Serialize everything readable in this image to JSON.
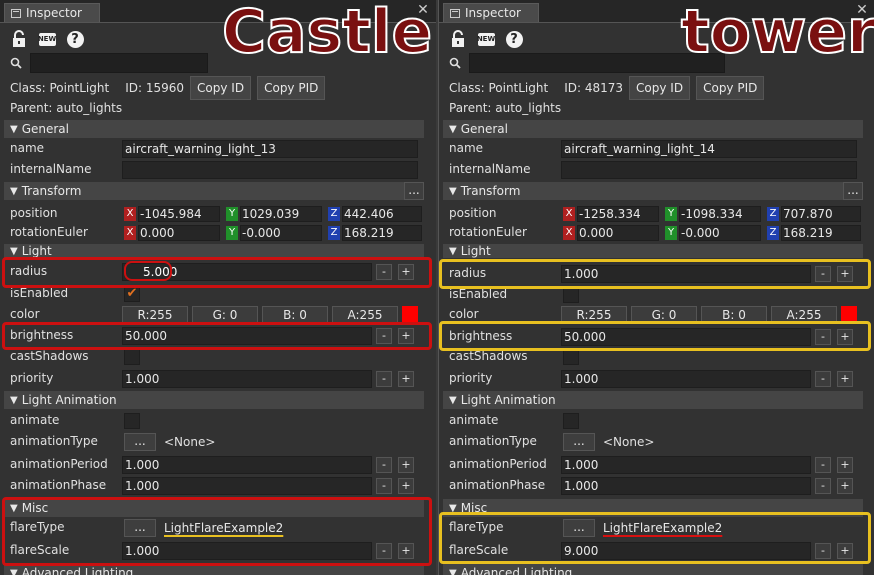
{
  "overlay_titles": {
    "left": "Castle",
    "right": "tower"
  },
  "left": {
    "tab": "Inspector",
    "icons": [
      "lock-icon",
      "new-badge-icon",
      "help-icon",
      "search-icon"
    ],
    "new_badge": "NEW",
    "help_glyph": "?",
    "info": {
      "class_label": "Class:",
      "class_value": "PointLight",
      "id_label": "ID:",
      "id_value": "15960",
      "copy_id": "Copy ID",
      "copy_pid": "Copy PID"
    },
    "parent": "Parent:  auto_lights",
    "sections": {
      "general": "General",
      "transform": "Transform",
      "light": "Light",
      "light_animation": "Light Animation",
      "misc": "Misc",
      "advanced": "Advanced Lighting"
    },
    "fields": {
      "name_label": "name",
      "name_value": "aircraft_warning_light_13",
      "internal_label": "internalName",
      "internal_value": "",
      "position_label": "position",
      "pos_x": "-1045.984",
      "pos_y": "1029.039",
      "pos_z": "442.406",
      "rot_label": "rotationEuler",
      "rot_x": "0.000",
      "rot_y": "-0.000",
      "rot_z": "168.219",
      "radius_label": "radius",
      "radius_value": "5.000",
      "enabled_label": "isEnabled",
      "enabled_check": "✔",
      "color_label": "color",
      "r": "R:255",
      "g": "G:  0",
      "b": "B:  0",
      "a": "A:255",
      "brightness_label": "brightness",
      "brightness_value": "50.000",
      "shadows_label": "castShadows",
      "priority_label": "priority",
      "priority_value": "1.000",
      "animate_label": "animate",
      "animtype_label": "animationType",
      "animtype_value": "<None>",
      "animperiod_label": "animationPeriod",
      "animperiod_value": "1.000",
      "animphase_label": "animationPhase",
      "animphase_value": "1.000",
      "flaretype_label": "flareType",
      "flaretype_value": "LightFlareExample2",
      "flarescale_label": "flareScale",
      "flarescale_value": "1.000"
    }
  },
  "right": {
    "tab": "Inspector",
    "info": {
      "class_label": "Class:",
      "class_value": "PointLight",
      "id_label": "ID:",
      "id_value": "48173",
      "copy_id": "Copy ID",
      "copy_pid": "Copy PID"
    },
    "parent": "Parent:  auto_lights",
    "fields": {
      "name_value": "aircraft_warning_light_14",
      "pos_x": "-1258.334",
      "pos_y": "-1098.334",
      "pos_z": "707.870",
      "rot_x": "0.000",
      "rot_y": "-0.000",
      "rot_z": "168.219",
      "radius_value": "1.000",
      "brightness_value": "50.000",
      "priority_value": "1.000",
      "animtype_value": "<None>",
      "animperiod_value": "1.000",
      "animphase_value": "1.000",
      "flaretype_value": "LightFlareExample2",
      "flarescale_value": "9.000"
    }
  },
  "buttons": {
    "minus": "-",
    "plus": "+",
    "dots": "...",
    "ellipsis": "...",
    "x_axis": "X",
    "y_axis": "Y",
    "z_axis": "Z",
    "close": "✕",
    "collapse": "▼"
  },
  "colors": {
    "highlight_left": "#cc1010",
    "highlight_right": "#e8c020",
    "x_axis": "#b02020",
    "y_axis": "#20902a",
    "z_axis": "#2040b0",
    "swatch": "#ff0000",
    "check": "#e07020"
  }
}
